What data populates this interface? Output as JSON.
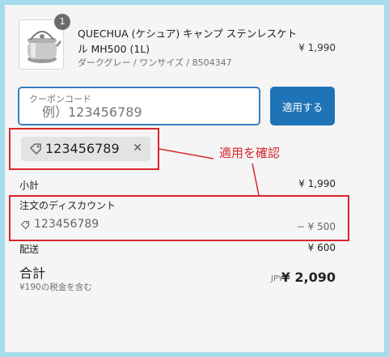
{
  "product": {
    "quantity": "1",
    "name": "QUECHUA (ケシュア) キャンプ ステンレスケトル MH500 (1L)",
    "variant": "ダークグレー / ワンサイズ / 8504347",
    "price": "¥ 1,990",
    "image_icon": "kettle-image"
  },
  "coupon": {
    "label": "クーポンコード",
    "placeholder": "例）123456789",
    "apply_label": "適用する",
    "applied_code": "123456789",
    "remove_icon": "close-icon"
  },
  "annotation": {
    "note": "適用を確認",
    "color": "#d9262c"
  },
  "summary": {
    "subtotal_label": "小計",
    "subtotal_value": "¥ 1,990",
    "discount_label": "注文のディスカウント",
    "discount_code": "123456789",
    "discount_value": "− ¥ 500",
    "shipping_label": "配送",
    "shipping_value": "¥ 600",
    "total_label": "合計",
    "tax_note": "¥190の税金を含む",
    "currency": "JPY",
    "total_value": "¥ 2,090"
  },
  "colors": {
    "accent": "#1f73b7",
    "focus_border": "#3a7ec2",
    "background": "#a6dcec"
  }
}
